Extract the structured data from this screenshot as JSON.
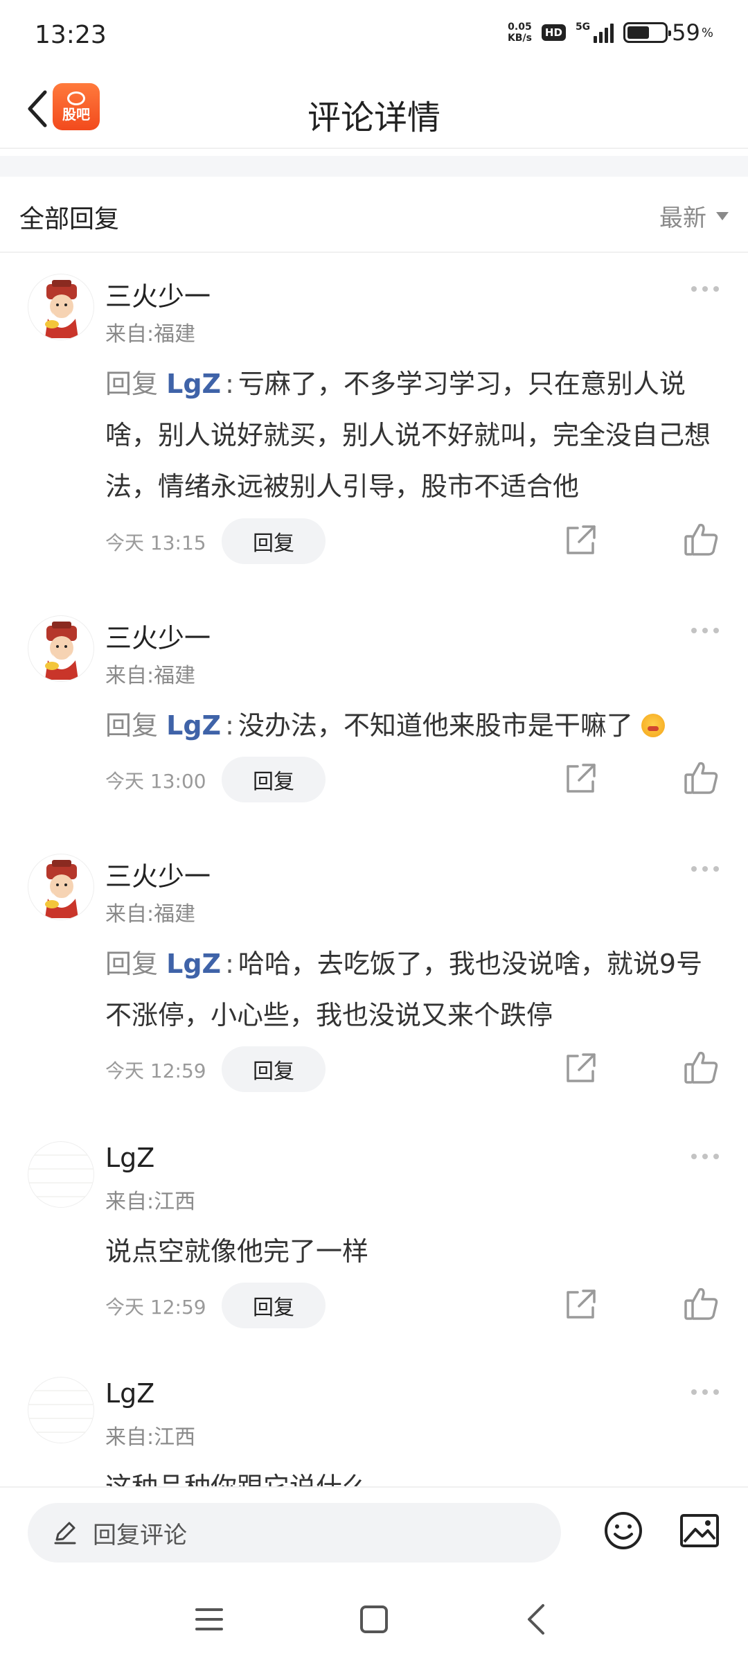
{
  "status_bar": {
    "time": "13:23",
    "net_speed_value": "0.05",
    "net_speed_unit": "KB/s",
    "hd": "HD",
    "network": "5G",
    "battery_percent": "59",
    "battery_percent_sign": "%",
    "battery_level": 0.59
  },
  "header": {
    "logo_text": "股吧",
    "title": "评论详情"
  },
  "filter": {
    "title": "全部回复",
    "sort_label": "最新"
  },
  "comments": [
    {
      "user": "三火少一",
      "location": "来自:福建",
      "reply_prefix": "回复",
      "mention": "LgZ",
      "colon": ":",
      "text": "亏麻了，不多学习学习，只在意别人说啥，别人说好就买，别人说不好就叫，完全没自己想法，情绪永远被别人引导，股市不适合他",
      "time": "今天 13:15",
      "reply_label": "回复"
    },
    {
      "user": "三火少一",
      "location": "来自:福建",
      "reply_prefix": "回复",
      "mention": "LgZ",
      "colon": ":",
      "text": "没办法，不知道他来股市是干嘛了",
      "time": "今天 13:00",
      "reply_label": "回复"
    },
    {
      "user": "三火少一",
      "location": "来自:福建",
      "reply_prefix": "回复",
      "mention": "LgZ",
      "colon": ":",
      "text": "哈哈，去吃饭了，我也没说啥，就说9号不涨停，小心些，我也没说又来个跌停",
      "time": "今天 12:59",
      "reply_label": "回复"
    },
    {
      "user": "LgZ",
      "location": "来自:江西",
      "text": "说点空就像他完了一样",
      "time": "今天 12:59",
      "reply_label": "回复"
    },
    {
      "user": "LgZ",
      "location": "来自:江西",
      "text": "这种品种你跟它说什么"
    }
  ],
  "input_bar": {
    "placeholder": "回复评论"
  },
  "icons": {
    "back": "chevron-left-icon",
    "more": "more-dots-icon",
    "share": "share-icon",
    "like": "thumbs-up-icon",
    "edit": "pencil-icon",
    "emoji": "smiley-icon",
    "image": "image-icon"
  },
  "colors": {
    "mention": "#3f63a8",
    "logo": "#f24a1d",
    "secondary_text": "#8a8a8a"
  }
}
